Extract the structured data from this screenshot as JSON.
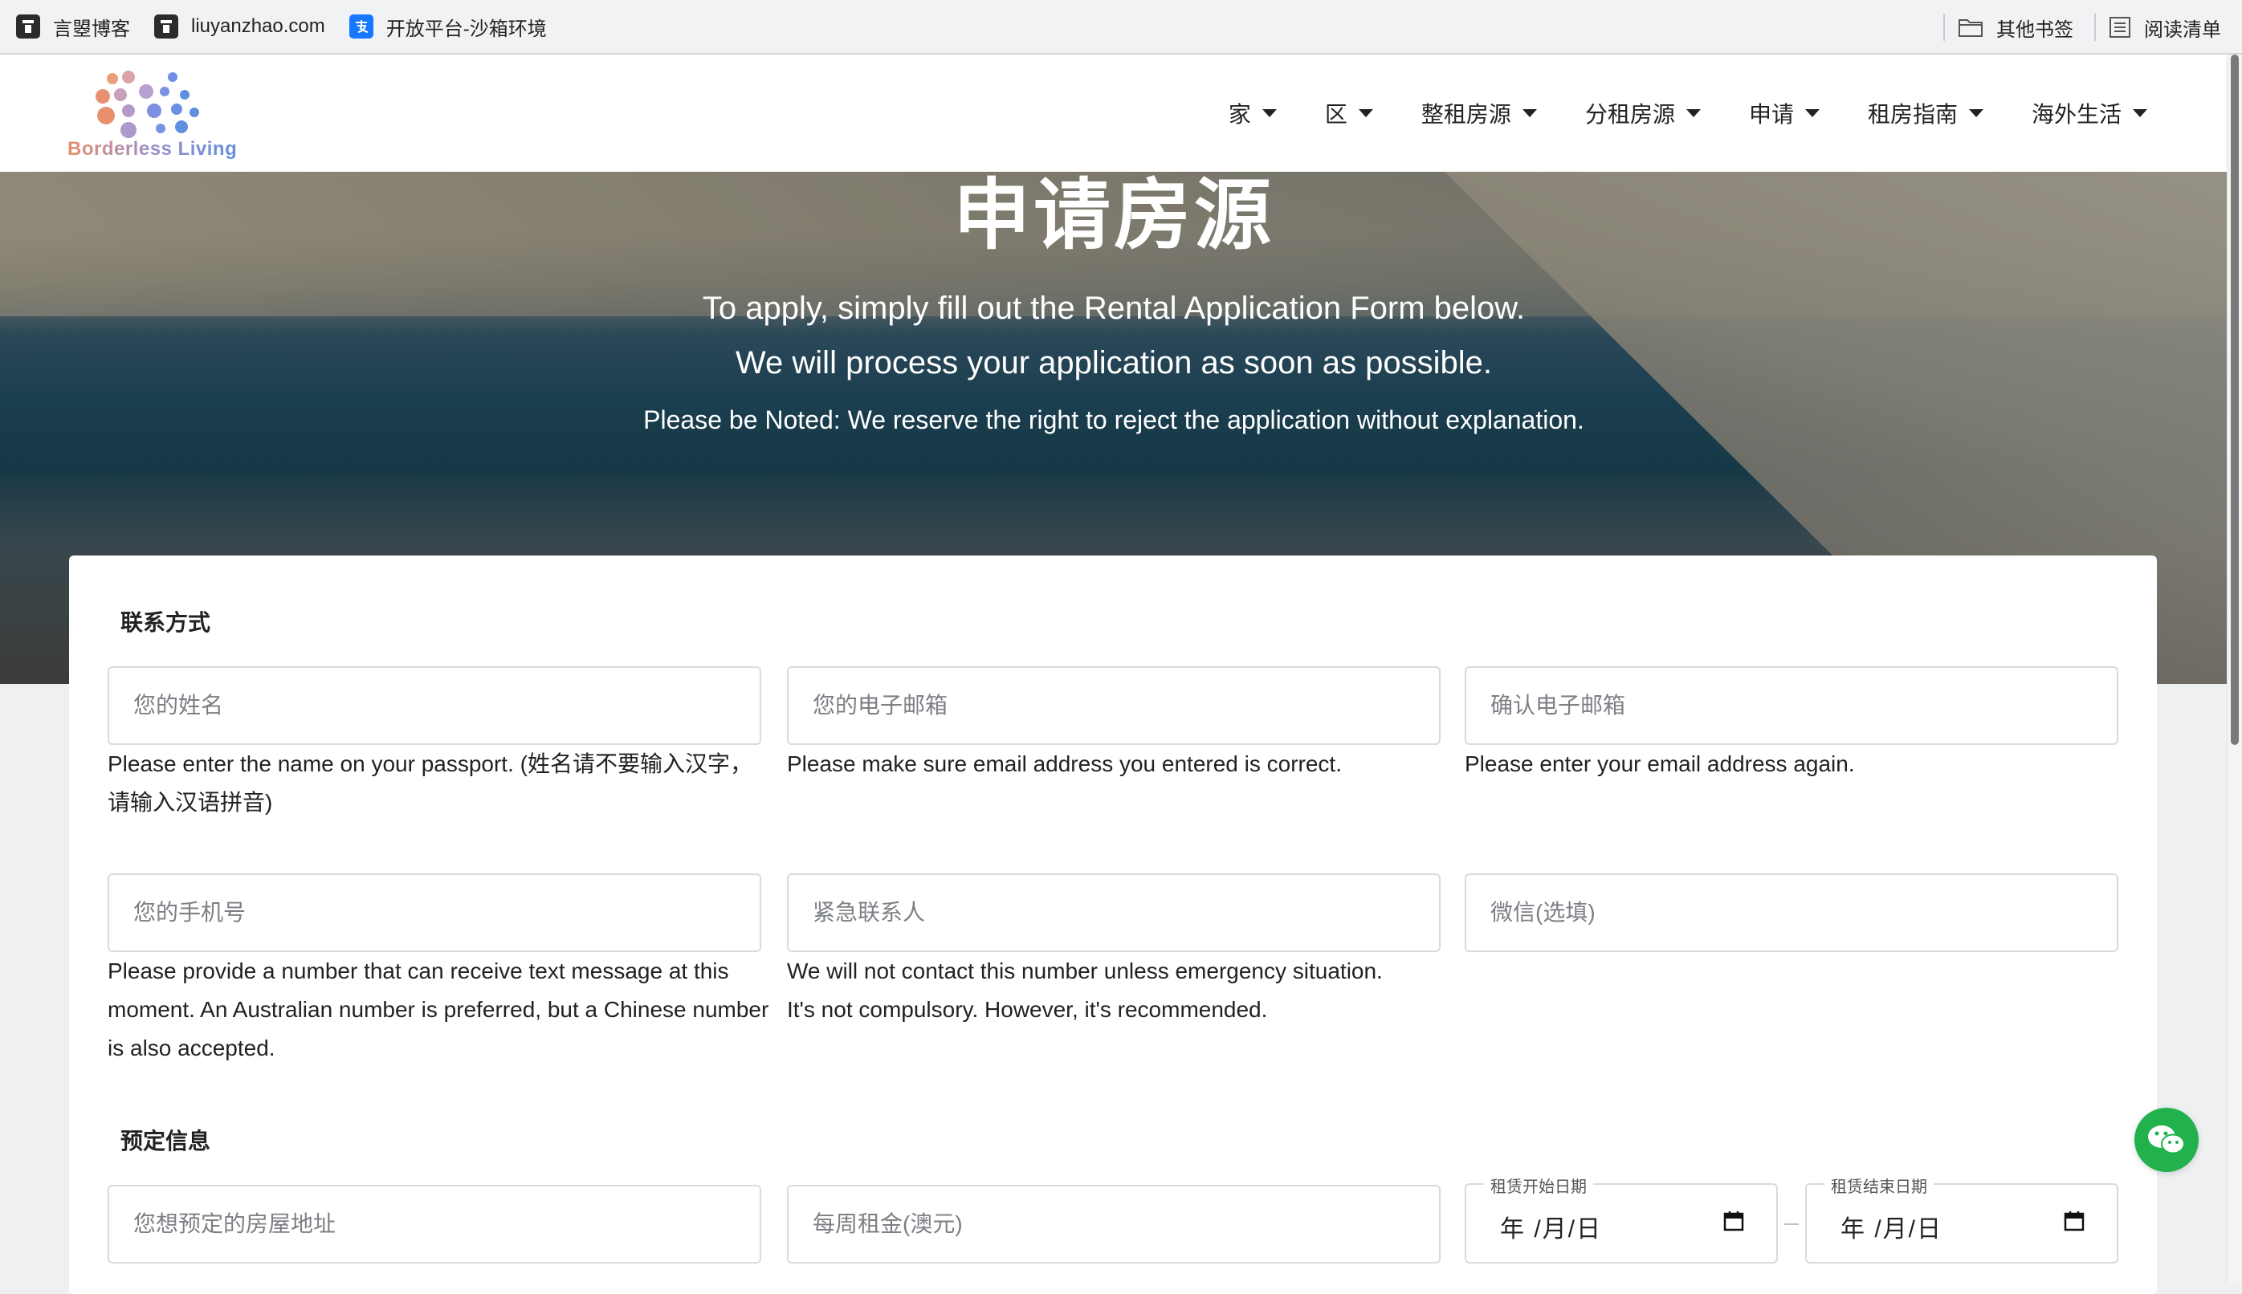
{
  "bookmarks_bar": {
    "items": [
      {
        "label": "言曌博客",
        "icon": "bookmark-favicon-icon"
      },
      {
        "label": "liuyanzhao.com",
        "icon": "bookmark-favicon-icon"
      },
      {
        "label": "开放平台-沙箱环境",
        "icon": "alipay-icon"
      }
    ],
    "other_bookmarks": "其他书签",
    "reading_list": "阅读清单"
  },
  "header": {
    "logo_text": "Borderless Living",
    "nav": [
      {
        "label": "家"
      },
      {
        "label": "区"
      },
      {
        "label": "整租房源"
      },
      {
        "label": "分租房源"
      },
      {
        "label": "申请"
      },
      {
        "label": "租房指南"
      },
      {
        "label": "海外生活"
      }
    ]
  },
  "hero": {
    "title": "申请房源",
    "subtitle_line1": "To apply, simply fill out the Rental Application Form below.",
    "subtitle_line2": "We will process your application as soon as possible.",
    "note": "Please be Noted: We reserve the right to reject the application without explanation."
  },
  "form": {
    "contact": {
      "title": "联系方式",
      "name": {
        "placeholder": "您的姓名",
        "help": "Please enter the name on your passport. (姓名请不要输入汉字，请输入汉语拼音)"
      },
      "email": {
        "placeholder": "您的电子邮箱",
        "help": "Please make sure email address you entered is correct."
      },
      "confirm_email": {
        "placeholder": "确认电子邮箱",
        "help": "Please enter your email address again."
      },
      "phone": {
        "placeholder": "您的手机号",
        "help": "Please provide a number that can receive text message at this moment. An Australian number is preferred, but a Chinese number is also accepted."
      },
      "emergency": {
        "placeholder": "紧急联系人",
        "help": "We will not contact this number unless emergency situation. It's not compulsory. However, it's recommended."
      },
      "wechat": {
        "placeholder": "微信(选填)"
      }
    },
    "booking": {
      "title": "预定信息",
      "address": {
        "placeholder": "您想预定的房屋地址"
      },
      "rent": {
        "placeholder": "每周租金(澳元)"
      },
      "start_date": {
        "label": "租赁开始日期",
        "value": "年 /月/日"
      },
      "end_date": {
        "label": "租赁结束日期",
        "value": "年 /月/日"
      }
    }
  },
  "colors": {
    "wechat_green": "#22b14c",
    "logo_gradient": [
      "#e8906e",
      "#9b8fc9",
      "#5f8fe0"
    ]
  }
}
